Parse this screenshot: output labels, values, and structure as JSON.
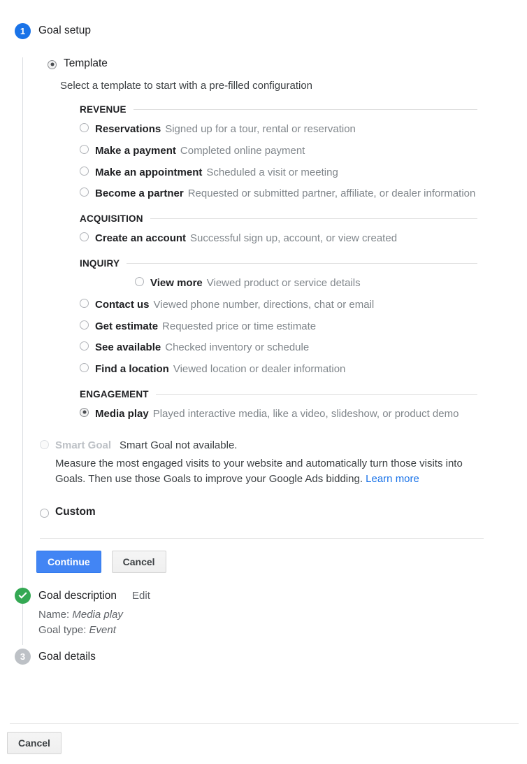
{
  "wizard": {
    "step1": {
      "badge": "1",
      "title": "Goal setup"
    },
    "step2": {
      "title": "Goal description",
      "edit_label": "Edit"
    },
    "step3": {
      "badge": "3",
      "title": "Goal details"
    }
  },
  "template": {
    "label": "Template",
    "lead": "Select a template to start with a pre-filled configuration",
    "groups": [
      {
        "name": "REVENUE",
        "options": [
          {
            "name": "Reservations",
            "desc": "Signed up for a tour, rental or reservation",
            "selected": false,
            "indent": false
          },
          {
            "name": "Make a payment",
            "desc": "Completed online payment",
            "selected": false,
            "indent": false
          },
          {
            "name": "Make an appointment",
            "desc": "Scheduled a visit or meeting",
            "selected": false,
            "indent": false
          },
          {
            "name": "Become a partner",
            "desc": "Requested or submitted partner, affiliate, or dealer information",
            "selected": false,
            "indent": false
          }
        ]
      },
      {
        "name": "ACQUISITION",
        "options": [
          {
            "name": "Create an account",
            "desc": "Successful sign up, account, or view created",
            "selected": false,
            "indent": false
          }
        ]
      },
      {
        "name": "INQUIRY",
        "options": [
          {
            "name": "View more",
            "desc": "Viewed product or service details",
            "selected": false,
            "indent": true
          },
          {
            "name": "Contact us",
            "desc": "Viewed phone number, directions, chat or email",
            "selected": false,
            "indent": false
          },
          {
            "name": "Get estimate",
            "desc": "Requested price or time estimate",
            "selected": false,
            "indent": false
          },
          {
            "name": "See available",
            "desc": "Checked inventory or schedule",
            "selected": false,
            "indent": false
          },
          {
            "name": "Find a location",
            "desc": "Viewed location or dealer information",
            "selected": false,
            "indent": false
          }
        ]
      },
      {
        "name": "ENGAGEMENT",
        "options": [
          {
            "name": "Media play",
            "desc": "Played interactive media, like a video, slideshow, or product demo",
            "selected": true,
            "indent": false
          }
        ]
      }
    ]
  },
  "smart_goal": {
    "label": "Smart Goal",
    "note": "Smart Goal not available.",
    "body": "Measure the most engaged visits to your website and automatically turn those visits into Goals. Then use those Goals to improve your Google Ads bidding.",
    "learn_more": "Learn more"
  },
  "custom": {
    "label": "Custom"
  },
  "actions": {
    "continue_label": "Continue",
    "cancel_label": "Cancel"
  },
  "goal_description": {
    "name_label": "Name:",
    "name_value": "Media play",
    "type_label": "Goal type:",
    "type_value": "Event"
  },
  "bottom_bar": {
    "cancel_label": "Cancel"
  },
  "colors": {
    "accent": "#1a73e8",
    "primary_button": "#4285f4",
    "success": "#34a853",
    "muted": "#80868b",
    "disabled": "#bdc1c6"
  }
}
